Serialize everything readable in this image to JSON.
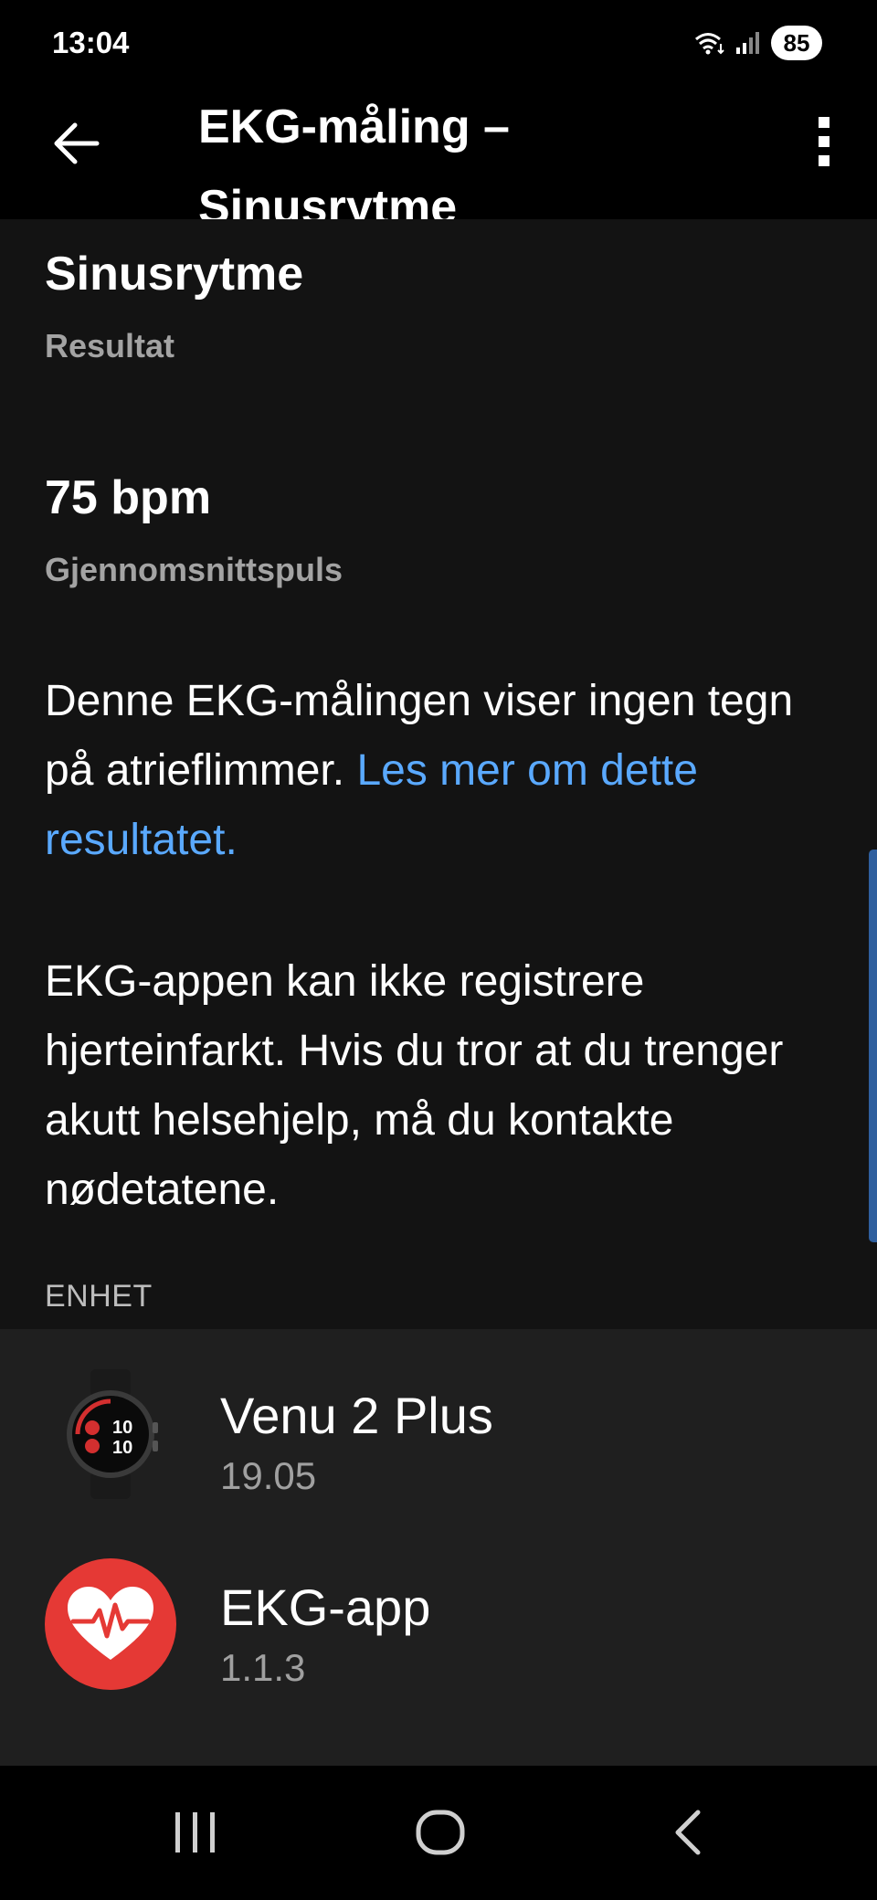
{
  "status_bar": {
    "time": "13:04",
    "battery": "85",
    "icons": [
      "wifi-icon",
      "signal-icon"
    ]
  },
  "app_bar": {
    "title": "EKG-måling – Sinusrytme",
    "back_icon": "arrow-left-icon",
    "menu_icon": "more-vertical-icon"
  },
  "result": {
    "title": "Sinusrytme",
    "label": "Resultat"
  },
  "heart_rate": {
    "value": "75 bpm",
    "label": "Gjennomsnittspuls"
  },
  "paragraph1": {
    "text": "Denne EKG-målingen viser ingen tegn på atrieflimmer. ",
    "link": "Les mer om dette resultatet."
  },
  "paragraph2": {
    "text": "EKG-appen kan ikke registrere hjerteinfarkt. Hvis du tror at du trenger akutt helsehjelp, må du kontakte nødetatene."
  },
  "device_section": {
    "header": "ENHET",
    "items": [
      {
        "name": "Venu 2 Plus",
        "version": "19.05",
        "icon": "watch-icon"
      },
      {
        "name": "EKG-app",
        "version": "1.1.3",
        "icon": "heart-ekg-icon"
      }
    ]
  },
  "nav_bar": {
    "buttons": [
      "recent-apps-icon",
      "home-icon",
      "back-icon"
    ]
  },
  "colors": {
    "background": "#131313",
    "bars": "#000000",
    "list_background": "#1f1f1f",
    "link": "#5aa9ff",
    "secondary_text": "#a3a3a3",
    "heart_red": "#e53935"
  }
}
